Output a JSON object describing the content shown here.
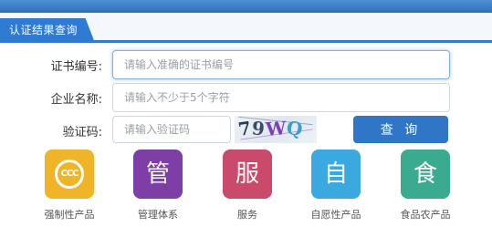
{
  "tab": {
    "label": "认证结果查询"
  },
  "form": {
    "cert_no": {
      "label": "证书编号:",
      "placeholder": "请输入准确的证书编号"
    },
    "company": {
      "label": "企业名称:",
      "placeholder": "请输入不少于5个字符"
    },
    "captcha": {
      "label": "验证码:",
      "placeholder": "请输入验证码",
      "image_text": [
        "7",
        "9",
        "W",
        "Q"
      ]
    },
    "query_button": "查 询"
  },
  "categories": [
    {
      "glyph": "CCC",
      "label": "强制性产品",
      "color": "#f0b429"
    },
    {
      "glyph": "管",
      "label": "管理体系",
      "color": "#7d3fa6"
    },
    {
      "glyph": "服",
      "label": "服务",
      "color": "#c94a6a"
    },
    {
      "glyph": "自",
      "label": "自愿性产品",
      "color": "#3ba9e0"
    },
    {
      "glyph": "食",
      "label": "食品农产品",
      "color": "#3aab8e"
    }
  ],
  "colors": {
    "accent": "#2f7bd3",
    "button": "#2f77c6"
  }
}
